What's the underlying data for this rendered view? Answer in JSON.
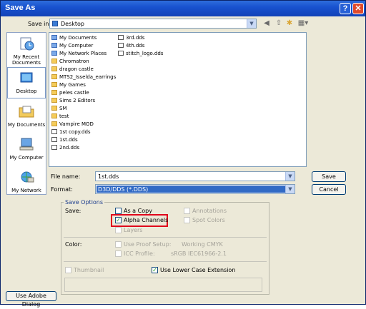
{
  "title": "Save As",
  "title_buttons": {
    "help": "?",
    "close": "✕"
  },
  "save_in": {
    "label": "Save in:",
    "value": "Desktop"
  },
  "places": [
    {
      "name": "recent",
      "label": "My Recent Documents"
    },
    {
      "name": "desktop",
      "label": "Desktop"
    },
    {
      "name": "documents",
      "label": "My Documents"
    },
    {
      "name": "computer",
      "label": "My Computer"
    },
    {
      "name": "network",
      "label": "My Network"
    }
  ],
  "files_col1": [
    {
      "name": "My Documents",
      "icon": "spec"
    },
    {
      "name": "My Computer",
      "icon": "spec"
    },
    {
      "name": "My Network Places",
      "icon": "spec"
    },
    {
      "name": "Chromatron",
      "icon": "folder"
    },
    {
      "name": "dragon castle",
      "icon": "folder"
    },
    {
      "name": "MTS2_Isselda_earrings",
      "icon": "folder"
    },
    {
      "name": "My Games",
      "icon": "folder"
    },
    {
      "name": "peles castle",
      "icon": "folder"
    },
    {
      "name": "Sims 2 Editors",
      "icon": "folder"
    },
    {
      "name": "SM",
      "icon": "folder"
    },
    {
      "name": "test",
      "icon": "folder"
    },
    {
      "name": "Vampire MOD",
      "icon": "folder"
    },
    {
      "name": "1st copy.dds",
      "icon": "dds"
    },
    {
      "name": "1st.dds",
      "icon": "dds"
    },
    {
      "name": "2nd.dds",
      "icon": "dds"
    }
  ],
  "files_col2": [
    {
      "name": "3rd.dds",
      "icon": "dds"
    },
    {
      "name": "4th.dds",
      "icon": "dds"
    },
    {
      "name": "stitch_logo.dds",
      "icon": "dds"
    }
  ],
  "file_name": {
    "label": "File name:",
    "value": "1st.dds"
  },
  "format": {
    "label": "Format:",
    "value": "D3D/DDS (*.DDS)"
  },
  "buttons": {
    "save": "Save",
    "cancel": "Cancel",
    "adobe": "Use Adobe Dialog"
  },
  "options": {
    "group_title": "Save Options",
    "save_label": "Save:",
    "as_copy": "As a Copy",
    "alpha": "Alpha Channels",
    "layers": "Layers",
    "annotations": "Annotations",
    "spot": "Spot Colors",
    "color_label": "Color:",
    "proof": "Use Proof Setup:",
    "proof_value": "Working CMYK",
    "icc": "ICC Profile:",
    "icc_value": "sRGB IEC61966-2.1",
    "thumbnail": "Thumbnail",
    "lowercase": "Use Lower Case Extension"
  },
  "colors": {
    "highlight": "#E0001B",
    "title_blue": "#1852CF",
    "select_blue": "#316AC5"
  }
}
